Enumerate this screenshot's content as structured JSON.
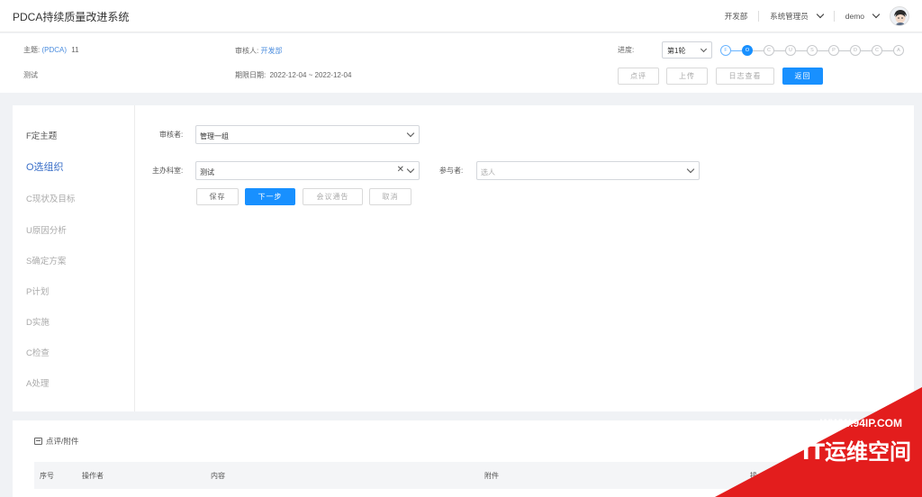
{
  "app": {
    "title": "PDCA持续质量改进系统"
  },
  "topbar": {
    "department": "开发部",
    "role": "系统管理员",
    "user": "demo"
  },
  "info": {
    "topic_label": "主题:",
    "topic_value": "(PDCA)",
    "topic_number": "11",
    "reviewer_label": "审核人:",
    "reviewer_value": "开发部",
    "progress_label": "进度:",
    "progress_value": "第1轮",
    "desc": "测试",
    "deadline_label": "期限日期:",
    "deadline_value": "2022-12-04 ~ 2022-12-04",
    "steps": [
      "F",
      "O",
      "C",
      "U",
      "S",
      "P",
      "D",
      "C",
      "A"
    ],
    "active_step": 2,
    "buttons": {
      "review": "点评",
      "upload": "上传",
      "log": "日志查看",
      "back": "返回"
    }
  },
  "sidebar": {
    "items": [
      "F定主题",
      "O选组织",
      "C现状及目标",
      "U原因分析",
      "S确定方案",
      "P计划",
      "D实施",
      "C检查",
      "A处理"
    ],
    "active": 1
  },
  "form": {
    "reviewer_label": "审核者:",
    "reviewer_value": "管理一组",
    "dept_label": "主办科室:",
    "dept_value": "测试",
    "participants_label": "参与者:",
    "participants_placeholder": "选人",
    "buttons": {
      "save": "保存",
      "next": "下一步",
      "notice": "会议通告",
      "cancel": "取消"
    }
  },
  "comments": {
    "title": "点评/附件",
    "columns": [
      "序号",
      "操作者",
      "内容",
      "附件",
      "操"
    ]
  },
  "watermark": {
    "url": "WWW.94IP.COM",
    "text": "IT运维空间"
  }
}
